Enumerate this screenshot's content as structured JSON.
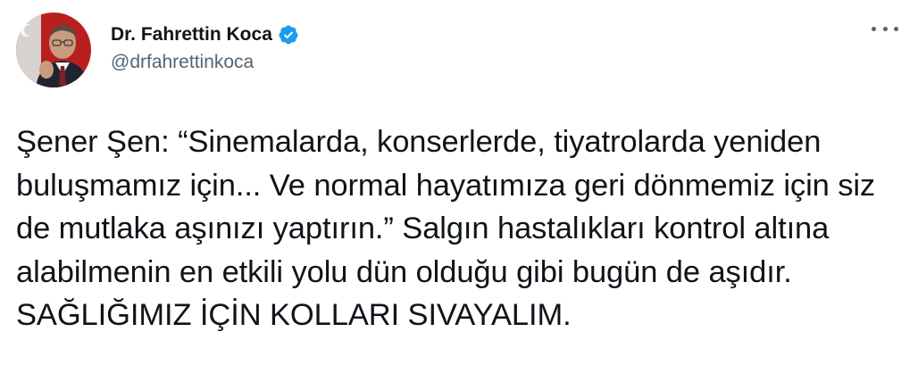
{
  "author": {
    "display_name": "Dr. Fahrettin Koca",
    "handle": "@drfahrettinkoca",
    "verified": true,
    "verified_icon": "verified-badge-icon",
    "avatar": "avatar-photo"
  },
  "menu": {
    "icon": "more-horizontal-icon"
  },
  "tweet": {
    "text": "Şener Şen: “Sinemalarda, konserlerde, tiyatrolarda yeniden buluşmamız için... Ve normal hayatımıza geri dönmemiz için siz de mutlaka aşınızı yaptırın.” Salgın hastalıkları kontrol altına alabilmenin en etkili yolu dün olduğu gibi bugün de aşıdır. SAĞLIĞIMIZ İÇİN KOLLARI SIVAYALIM."
  },
  "colors": {
    "text_primary": "#0f1419",
    "text_secondary": "#536471",
    "verified_blue": "#1d9bf0"
  }
}
